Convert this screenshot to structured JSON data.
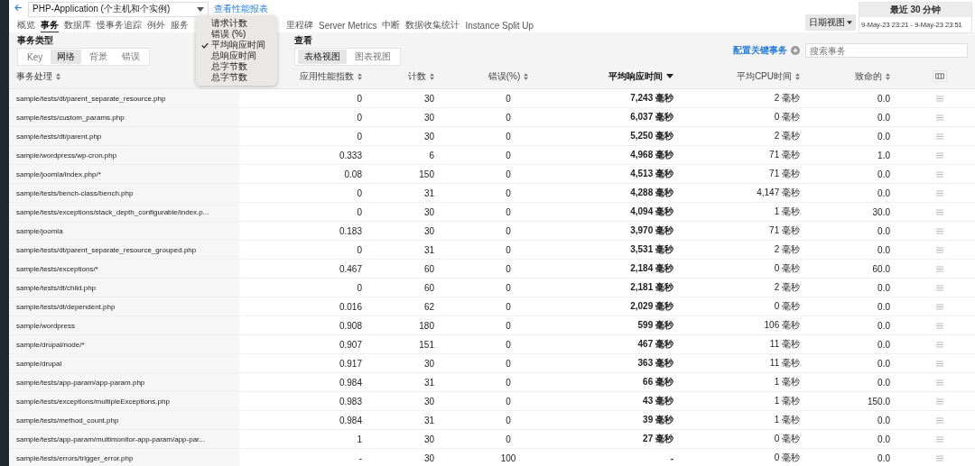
{
  "app_select": {
    "value": "PHP-Application (个主机和个实例)"
  },
  "report_link": "查看性能报表",
  "date_view_button": "日期视图",
  "time_range": {
    "title": "最近 30 分钟",
    "range": "9-May-23 23:21 - 9-May-23 23:51"
  },
  "tabs": [
    {
      "label": "概览",
      "selected": false
    },
    {
      "label": "事务",
      "selected": true
    },
    {
      "label": "数据库",
      "selected": false
    },
    {
      "label": "慢事务追踪",
      "selected": false
    },
    {
      "label": "例外",
      "selected": false
    },
    {
      "label": "服务",
      "selected": false
    },
    {
      "label": "里程碑",
      "selected": false
    },
    {
      "label": "Server Metrics",
      "selected": false
    },
    {
      "label": "中断",
      "selected": false
    },
    {
      "label": "数据收集统计",
      "selected": false
    },
    {
      "label": "Instance Split Up",
      "selected": false
    }
  ],
  "transaction_type": {
    "label": "事务类型",
    "options": [
      {
        "label": "Key",
        "selected": false
      },
      {
        "label": "网络",
        "selected": true
      },
      {
        "label": "背景",
        "selected": false
      },
      {
        "label": "错误",
        "selected": false
      }
    ]
  },
  "view": {
    "label": "查看",
    "options": [
      {
        "label": "表格视图",
        "selected": true
      },
      {
        "label": "图表视图",
        "selected": false
      }
    ]
  },
  "configure_link": "配置关键事务",
  "search": {
    "placeholder": "搜索事务"
  },
  "metric_menu": [
    {
      "label": "请求计数",
      "checked": false
    },
    {
      "label": "错误 (%)",
      "checked": false
    },
    {
      "label": "平均响应时间",
      "checked": true
    },
    {
      "label": "总响应时间",
      "checked": false
    },
    {
      "label": "总字节数",
      "checked": false
    },
    {
      "label": "总字节数",
      "checked": false
    }
  ],
  "table": {
    "columns": [
      {
        "label": "事务处理",
        "sorted": false
      },
      {
        "label": "应用性能指数",
        "sorted": false
      },
      {
        "label": "计数",
        "sorted": false
      },
      {
        "label": "错误(%)",
        "sorted": false
      },
      {
        "label": "平均响应时间",
        "sorted": true
      },
      {
        "label": "平均CPU时间",
        "sorted": false
      },
      {
        "label": "致命的",
        "sorted": false
      }
    ],
    "rows": [
      [
        "sample/tests/dt/parent_separate_resource.php",
        "0",
        "30",
        "0",
        "7,243 毫秒",
        "2 毫秒",
        "0.0"
      ],
      [
        "sample/tests/custom_params.php",
        "0",
        "30",
        "0",
        "6,037 毫秒",
        "0 毫秒",
        "0.0"
      ],
      [
        "sample/tests/dt/parent.php",
        "0",
        "30",
        "0",
        "5,250 毫秒",
        "2 毫秒",
        "0.0"
      ],
      [
        "sample/wordpress/wp-cron.php",
        "0.333",
        "6",
        "0",
        "4,968 毫秒",
        "71 毫秒",
        "1.0"
      ],
      [
        "sample/joomla/index.php/*",
        "0.08",
        "150",
        "0",
        "4,513 毫秒",
        "71 毫秒",
        "0.0"
      ],
      [
        "sample/tests/bench-class/bench.php",
        "0",
        "31",
        "0",
        "4,288 毫秒",
        "4,147 毫秒",
        "0.0"
      ],
      [
        "sample/tests/exceptions/stack_depth_configurable/index.p...",
        "0",
        "30",
        "0",
        "4,094 毫秒",
        "1 毫秒",
        "30.0"
      ],
      [
        "sample/joomla",
        "0.183",
        "30",
        "0",
        "3,970 毫秒",
        "71 毫秒",
        "0.0"
      ],
      [
        "sample/tests/dt/parent_separate_resource_grouped.php",
        "0",
        "31",
        "0",
        "3,531 毫秒",
        "2 毫秒",
        "0.0"
      ],
      [
        "sample/tests/exceptions/*",
        "0.467",
        "60",
        "0",
        "2,184 毫秒",
        "0 毫秒",
        "60.0"
      ],
      [
        "sample/tests/dt/child.php",
        "0",
        "60",
        "0",
        "2,181 毫秒",
        "2 毫秒",
        "0.0"
      ],
      [
        "sample/tests/dt/dependent.php",
        "0.016",
        "62",
        "0",
        "2,029 毫秒",
        "0 毫秒",
        "0.0"
      ],
      [
        "sample/wordpress",
        "0.908",
        "180",
        "0",
        "599 毫秒",
        "106 毫秒",
        "0.0"
      ],
      [
        "sample/drupal/node/*",
        "0.907",
        "151",
        "0",
        "467 毫秒",
        "11 毫秒",
        "0.0"
      ],
      [
        "sample/drupal",
        "0.917",
        "30",
        "0",
        "363 毫秒",
        "11 毫秒",
        "0.0"
      ],
      [
        "sample/tests/app-param/app-param.php",
        "0.984",
        "31",
        "0",
        "66 毫秒",
        "1 毫秒",
        "0.0"
      ],
      [
        "sample/tests/exceptions/multipleExceptions.php",
        "0.983",
        "30",
        "0",
        "43 毫秒",
        "1 毫秒",
        "150.0"
      ],
      [
        "sample/tests/method_count.php",
        "0.984",
        "31",
        "0",
        "39 毫秒",
        "1 毫秒",
        "0.0"
      ],
      [
        "sample/tests/app-param/multimonitor-app-param/app-par...",
        "1",
        "30",
        "0",
        "27 毫秒",
        "0 毫秒",
        "0.0"
      ],
      [
        "sample/tests/errors/trigger_error.php",
        "-",
        "30",
        "100",
        "-",
        "0 毫秒",
        "0.0"
      ]
    ]
  }
}
